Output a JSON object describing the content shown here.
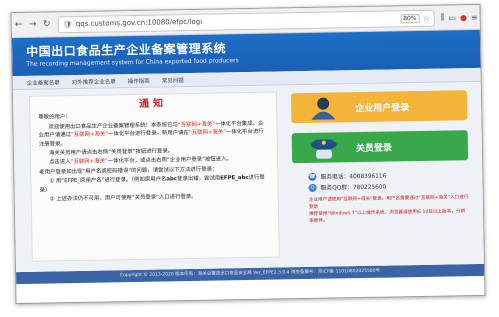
{
  "browser": {
    "url": "qqs.customs.gov.cn:10080/efpc/logi",
    "zoom": "80%",
    "back_icon": "arrow-left-icon",
    "forward_icon": "arrow-right-icon",
    "reload_icon": "reload-icon"
  },
  "header": {
    "title": "中国出口食品生产企业备案管理系统",
    "subtitle": "The recording management system for China exported food producers"
  },
  "nav": {
    "items": [
      "企业备案名录",
      "对外推荐企业名录",
      "操作指南",
      "常见问题"
    ]
  },
  "notice": {
    "title": "通知",
    "greeting": "尊敬的用户：",
    "paragraph1_a": "欢迎使用出口食品生产企业备案管理系统！本系统已与",
    "paragraph1_red1": "“互联网+海关”",
    "paragraph1_b": "一体化平台集成，企业用户请通过",
    "paragraph1_red2": "“互联网+海关”",
    "paragraph1_c": "一体化平台进行登录，新用户请在",
    "paragraph1_red3": "“互联网+海关”",
    "paragraph1_d": "一体化平台进行注册登录。",
    "paragraph2": "海关关员用户请点击右侧“关员登录”按钮进行登录。",
    "paragraph3_a": "点击进入",
    "paragraph3_red": "“互联网+海关”",
    "paragraph3_b": "一体化平台，或点击右侧“企业用户登录”按钮进入。",
    "paragraph4": "老用户登录如出现“用户名或密码错误”的问题，请尝试以下方法进行登录：",
    "step1_a": "① 用“EFPE_原用户名”进行登录。（例如原用户名",
    "step1_bold": "abc",
    "step1_b": "登录出错，尝试用",
    "step1_bold2": "EFPE_abc",
    "step1_c": "进行登录）",
    "step2": "② 上述办法仍不可用，用户可使用“关员登录”入口进行登录。"
  },
  "actions": {
    "enterprise_login": "企业用户登录",
    "customs_login": "关员登录"
  },
  "contact": {
    "phone": "服务电话：4008396116",
    "qq": "服务QQ群：780225600"
  },
  "notes": {
    "line1": "企业用户请使用“互联网+海关”登录，用户名需要通过“互联网+海关”入口进行登录",
    "line2": "推荐使用“Windows 7”以上操作系统，浏览器请使用IE 10及以上版本，分辨率推荐。"
  },
  "footer": {
    "text": "Copyright © 2013-2020 版本所有：海关总署进出口食品安全局  Ver_EFPE2.3.0.4  海关备案号：京ICP备 11010802025580号"
  }
}
